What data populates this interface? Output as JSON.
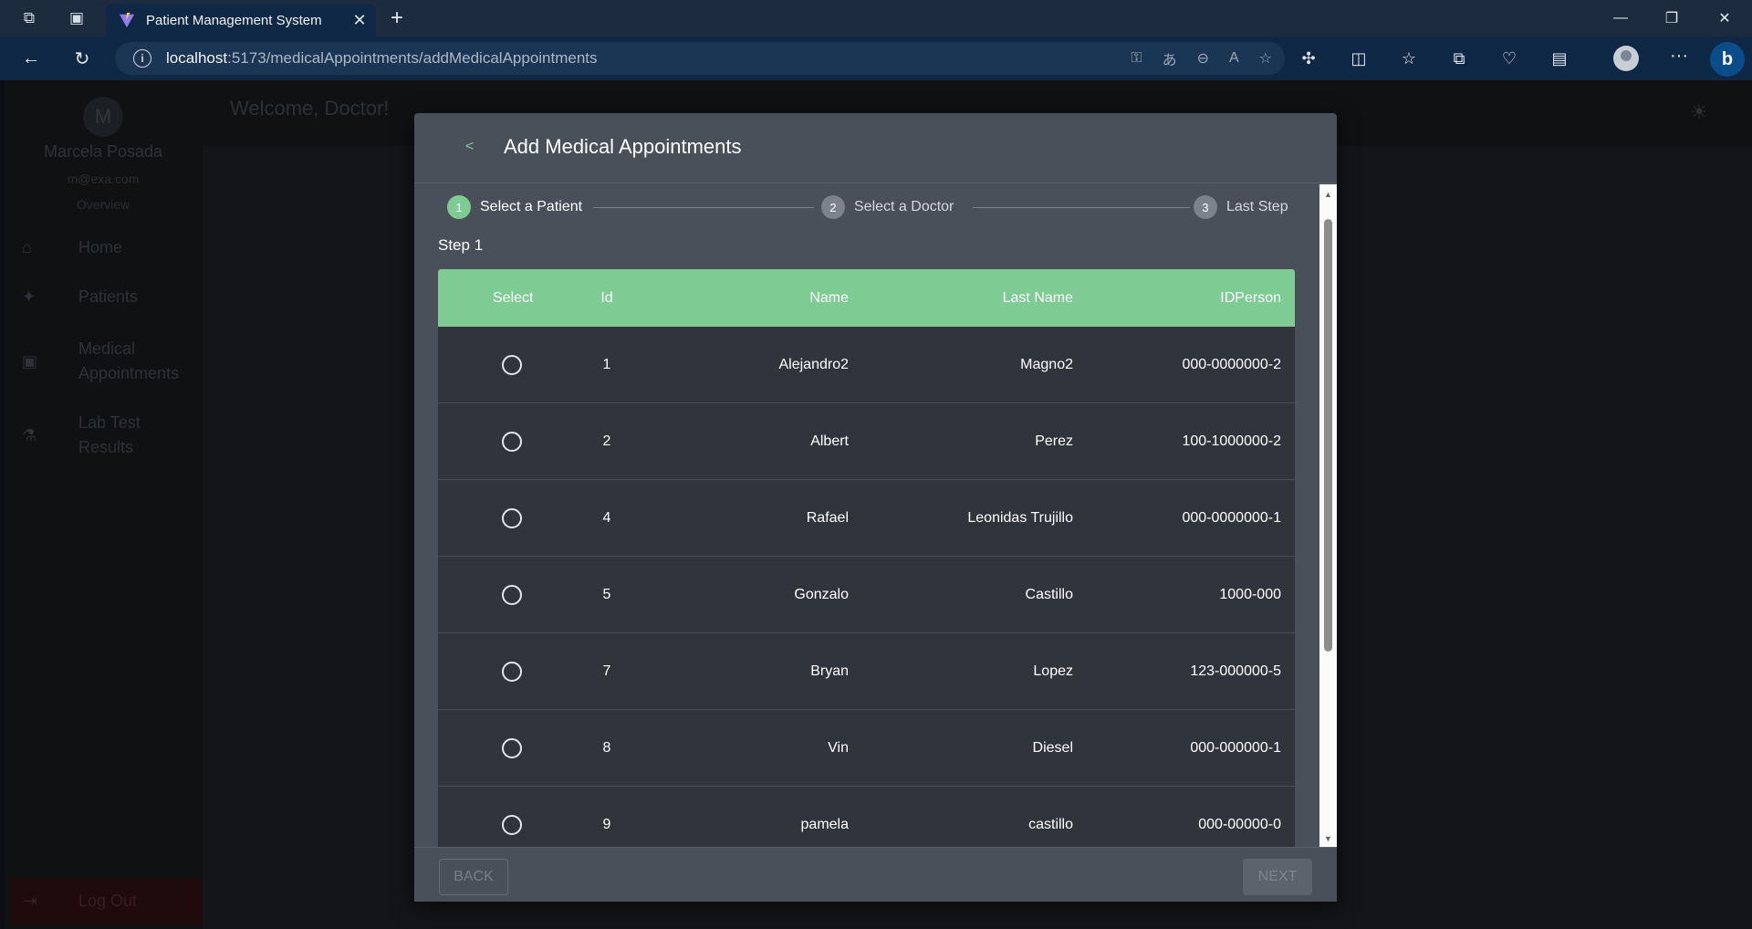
{
  "browser": {
    "tab_title": "Patient Management System",
    "url_host": "localhost",
    "url_path": ":5173/medicalAppointments/addMedicalAppointments"
  },
  "app": {
    "user_initial": "M",
    "user_name": "Marcela Posada",
    "user_email": "m@exa.com",
    "overview": "Overview",
    "welcome": "Welcome, Doctor!",
    "nav": [
      {
        "label": "Home"
      },
      {
        "label": "Patients"
      },
      {
        "label": "Medical",
        "label2": "Appointments"
      },
      {
        "label": "Lab Test",
        "label2": "Results"
      }
    ],
    "logout": "Log Out"
  },
  "modal": {
    "back_symbol": "<",
    "title": "Add Medical Appointments",
    "steps": [
      {
        "number": "1",
        "label": "Select a Patient",
        "active": true
      },
      {
        "number": "2",
        "label": "Select a Doctor",
        "active": false
      },
      {
        "number": "3",
        "label": "Last Step",
        "active": false
      }
    ],
    "step_heading": "Step 1",
    "table": {
      "headers": [
        "Select",
        "Id",
        "Name",
        "Last Name",
        "IDPerson"
      ],
      "rows": [
        {
          "id": "1",
          "name": "Alejandro2",
          "last_name": "Magno2",
          "idperson": "000-0000000-2"
        },
        {
          "id": "2",
          "name": "Albert",
          "last_name": "Perez",
          "idperson": "100-1000000-2"
        },
        {
          "id": "4",
          "name": "Rafael",
          "last_name": "Leonidas Trujillo",
          "idperson": "000-0000000-1"
        },
        {
          "id": "5",
          "name": "Gonzalo",
          "last_name": "Castillo",
          "idperson": "1000-000"
        },
        {
          "id": "7",
          "name": "Bryan",
          "last_name": "Lopez",
          "idperson": "123-000000-5"
        },
        {
          "id": "8",
          "name": "Vin",
          "last_name": "Diesel",
          "idperson": "000-000000-1"
        },
        {
          "id": "9",
          "name": "pamela",
          "last_name": "castillo",
          "idperson": "000-00000-0"
        }
      ]
    },
    "back_button": "BACK",
    "next_button": "NEXT"
  },
  "colors": {
    "accent_green": "#7ecb93",
    "modal_bg": "#4a5059",
    "row_bg": "#30353c"
  }
}
